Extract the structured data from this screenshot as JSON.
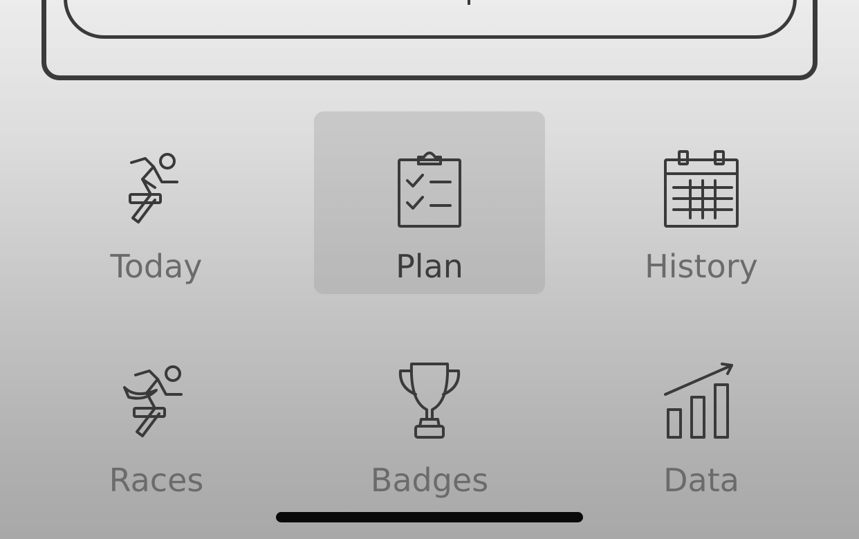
{
  "menu": {
    "tiles": [
      {
        "label": "Today",
        "icon": "running-person-icon",
        "selected": false
      },
      {
        "label": "Plan",
        "icon": "clipboard-checklist-icon",
        "selected": true
      },
      {
        "label": "History",
        "icon": "calendar-icon",
        "selected": false
      },
      {
        "label": "Races",
        "icon": "race-runner-icon",
        "selected": false
      },
      {
        "label": "Badges",
        "icon": "trophy-icon",
        "selected": false
      },
      {
        "label": "Data",
        "icon": "bar-chart-trend-icon",
        "selected": false
      }
    ]
  },
  "colors": {
    "icon_stroke": "#3a3a3a",
    "label_default": "#6b6b6b",
    "label_selected": "#3c3c3c",
    "selected_tile_bg": "rgba(150,150,150,0.30)"
  }
}
